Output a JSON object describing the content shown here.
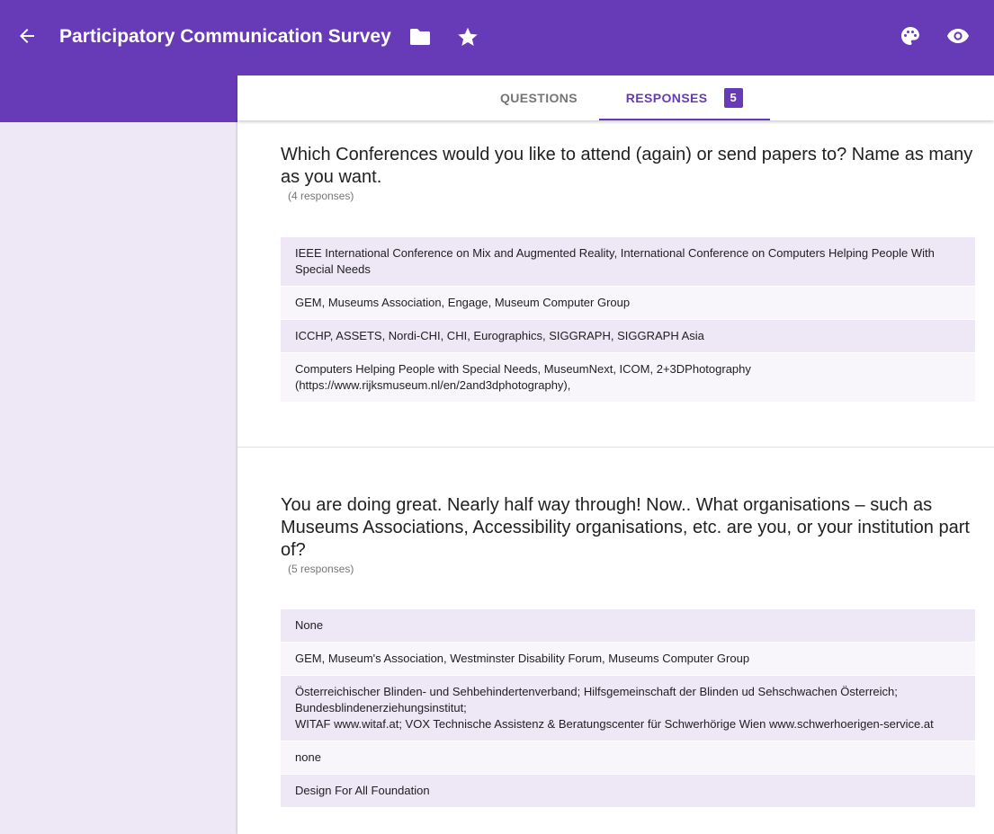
{
  "header": {
    "title": "Participatory Communication Survey",
    "icons": [
      "back-arrow-icon",
      "folder-icon",
      "star-icon",
      "palette-icon",
      "eye-icon"
    ],
    "accent_color": "#673ab7"
  },
  "tabs": {
    "questions_label": "QUESTIONS",
    "responses_label": "RESPONSES",
    "responses_count": "5",
    "active": "RESPONSES"
  },
  "questions": [
    {
      "title": "Which Conferences would you like to attend (again) or send papers to? Name as many as you want.",
      "count": "(4 responses)",
      "answers": [
        "IEEE International Conference on Mix and Augmented Reality, International Conference on Computers Helping People With Special Needs",
        "GEM, Museums Association, Engage, Museum Computer Group",
        "ICCHP, ASSETS, Nordi-CHI, CHI, Eurographics, SIGGRAPH, SIGGRAPH Asia",
        "Computers Helping People with Special Needs, MuseumNext, ICOM, 2+3DPhotography (https://www.rijksmuseum.nl/en/2and3dphotography),"
      ]
    },
    {
      "title": "You are doing great. Nearly half way through! Now.. What organisations – such as Museums Associations, Accessibility organisations, etc. are you, or your institution part of?",
      "count": "(5 responses)",
      "answers": [
        "None",
        "GEM, Museum's Association, Westminster Disability Forum, Museums Computer Group",
        "Österreichischer Blinden- und Sehbehindertenverband; Hilfsgemeinschaft der Blinden ud Sehschwachen Österreich; Bundesblindenerziehungsinstitut;",
        "WITAF www.witaf.at; VOX Technische Assistenz & Beratungscenter für Schwerhörige Wien www.schwerhoerigen-service.at",
        "none",
        "Design For All Foundation"
      ]
    }
  ]
}
